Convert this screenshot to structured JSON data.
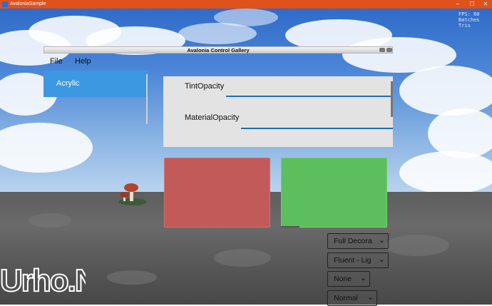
{
  "window": {
    "title": "AvaloniaSample",
    "controls": {
      "minimize": "–",
      "maximize": "☐",
      "close": "✕"
    }
  },
  "overlay": {
    "stats_lines": [
      "FPS: 60",
      "Batches",
      "Tris"
    ]
  },
  "gallery": {
    "title": "Avalonia Control Gallery",
    "menu": [
      "File",
      "Help"
    ],
    "nav_selected": "Acrylic",
    "sliders": [
      {
        "label": "TintOpacity"
      },
      {
        "label": "MaterialOpacity"
      }
    ],
    "card_colors": {
      "red": "#c25a5a",
      "green": "#5dbe5d"
    },
    "combos": [
      {
        "value": "Full Decora"
      },
      {
        "value": "Fluent - Lig"
      },
      {
        "value": "None"
      },
      {
        "value": "Normal"
      }
    ]
  },
  "branding": {
    "logo": "Urho.Net"
  },
  "colors": {
    "accent": "#3c98e0",
    "titlebar": "#e0521c"
  }
}
